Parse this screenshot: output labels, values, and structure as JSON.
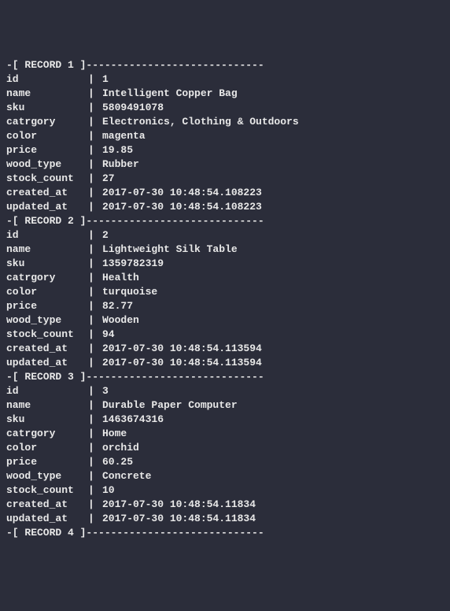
{
  "fields": [
    "id",
    "name",
    "sku",
    "catrgory",
    "color",
    "price",
    "wood_type",
    "stock_count",
    "created_at",
    "updated_at"
  ],
  "records": [
    {
      "header": "-[ RECORD 1 ]-----------------------------",
      "id": "1",
      "name": "Intelligent Copper Bag",
      "sku": "5809491078",
      "catrgory": "Electronics, Clothing & Outdoors",
      "color": "magenta",
      "price": "19.85",
      "wood_type": "Rubber",
      "stock_count": "27",
      "created_at": "2017-07-30 10:48:54.108223",
      "updated_at": "2017-07-30 10:48:54.108223"
    },
    {
      "header": "-[ RECORD 2 ]-----------------------------",
      "id": "2",
      "name": "Lightweight Silk Table",
      "sku": "1359782319",
      "catrgory": "Health",
      "color": "turquoise",
      "price": "82.77",
      "wood_type": "Wooden",
      "stock_count": "94",
      "created_at": "2017-07-30 10:48:54.113594",
      "updated_at": "2017-07-30 10:48:54.113594"
    },
    {
      "header": "-[ RECORD 3 ]-----------------------------",
      "id": "3",
      "name": "Durable Paper Computer",
      "sku": "1463674316",
      "catrgory": "Home",
      "color": "orchid",
      "price": "60.25",
      "wood_type": "Concrete",
      "stock_count": "10",
      "created_at": "2017-07-30 10:48:54.11834",
      "updated_at": "2017-07-30 10:48:54.11834"
    },
    {
      "header": "-[ RECORD 4 ]-----------------------------"
    }
  ],
  "separator": "|"
}
